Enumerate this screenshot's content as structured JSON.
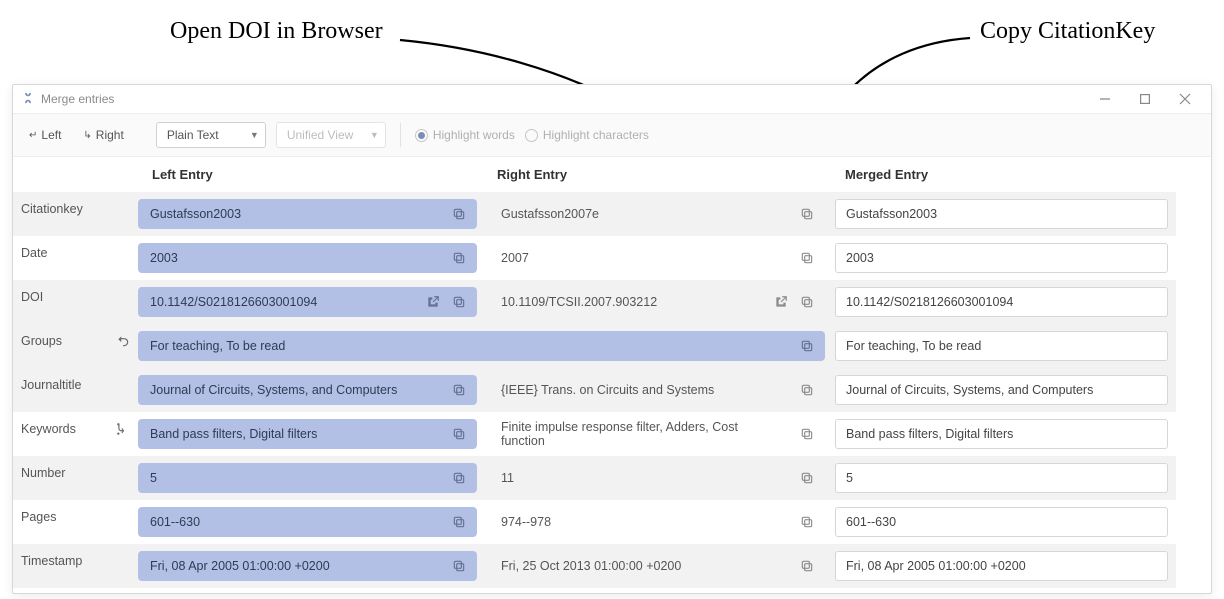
{
  "annotations": {
    "open_doi": "Open DOI in Browser",
    "copy_key": "Copy CitationKey"
  },
  "window": {
    "title": "Merge entries"
  },
  "toolbar": {
    "left_btn": "Left",
    "right_btn": "Right",
    "select_plain": "Plain Text",
    "select_unified": "Unified View",
    "radio_words": "Highlight words",
    "radio_chars": "Highlight characters"
  },
  "headers": {
    "left": "Left Entry",
    "right": "Right Entry",
    "merged": "Merged Entry"
  },
  "rows": {
    "citationkey": {
      "label": "Citationkey",
      "left": "Gustafsson2003",
      "right": "Gustafsson2007e",
      "merged": "Gustafsson2003"
    },
    "date": {
      "label": "Date",
      "left": "2003",
      "right": "2007",
      "merged": "2003"
    },
    "doi": {
      "label": "DOI",
      "left": "10.1142/S0218126603001094",
      "right": "10.1109/TCSII.2007.903212",
      "merged": "10.1142/S0218126603001094"
    },
    "groups": {
      "label": "Groups",
      "value": "For teaching, To be read",
      "merged": "For teaching, To be read"
    },
    "journaltitle": {
      "label": "Journaltitle",
      "left": "Journal of Circuits, Systems, and Computers",
      "right": "{IEEE} Trans. on Circuits and Systems",
      "merged": "Journal of Circuits, Systems, and Computers"
    },
    "keywords": {
      "label": "Keywords",
      "left": "Band pass filters, Digital filters",
      "right": "Finite impulse response filter, Adders, Cost function",
      "merged": "Band pass filters, Digital filters"
    },
    "number": {
      "label": "Number",
      "left": "5",
      "right": "11",
      "merged": "5"
    },
    "pages": {
      "label": "Pages",
      "left": "601--630",
      "right": "974--978",
      "merged": "601--630"
    },
    "timestamp": {
      "label": "Timestamp",
      "left": "Fri, 08 Apr 2005 01:00:00 +0200",
      "right": "Fri, 25 Oct 2013 01:00:00 +0200",
      "merged": "Fri, 08 Apr 2005 01:00:00 +0200"
    }
  }
}
